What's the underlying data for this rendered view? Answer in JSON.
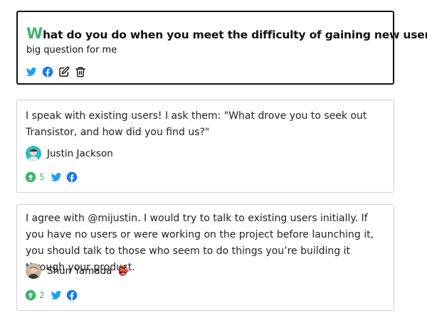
{
  "question": {
    "title_initial": "W",
    "title_rest": "hat do you do when you meet the difficulty of gaining new users?",
    "body": "big question for me",
    "actions": [
      "twitter-icon",
      "facebook-icon",
      "edit-icon",
      "trash-icon"
    ]
  },
  "answers": [
    {
      "text": "I speak with existing users! I ask them: \"What drove you to seek out Transistor, and how did you find us?\"",
      "author": "Justin Jackson",
      "votes": "5"
    },
    {
      "text": "I agree with @mijustin. I would try to talk to existing users initially. If you have no users or were working on the project before launching it, you should talk to those who seem to do things you’re building it through your product.",
      "author": "Shun Yamada",
      "author_emoji": "👺",
      "votes": "2"
    }
  ],
  "colors": {
    "accent_green": "#3fb66e",
    "twitter_blue": "#1da1f2",
    "facebook_blue": "#1877f2"
  }
}
